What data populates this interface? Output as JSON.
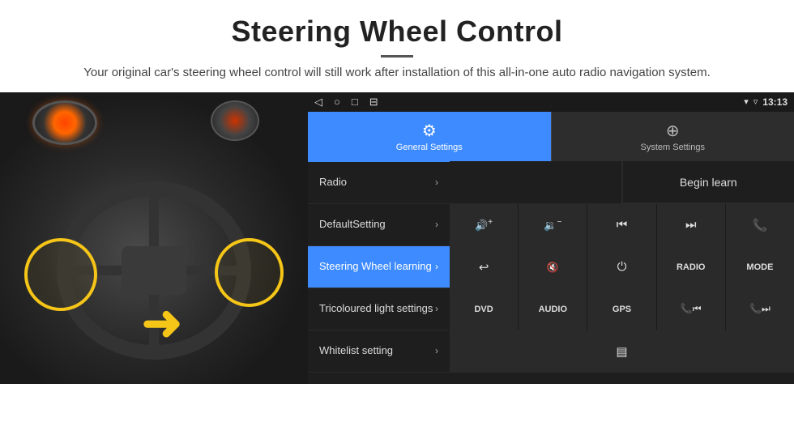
{
  "header": {
    "title": "Steering Wheel Control",
    "subtitle": "Your original car's steering wheel control will still work after installation of this all-in-one auto radio navigation system.",
    "divider": true
  },
  "status_bar": {
    "nav_back": "◁",
    "nav_home": "○",
    "nav_recent": "□",
    "nav_menu": "⊟",
    "signal_icon": "▾",
    "wifi_icon": "▿",
    "time": "13:13"
  },
  "tabs": [
    {
      "id": "general",
      "label": "General Settings",
      "icon": "⚙",
      "active": true
    },
    {
      "id": "system",
      "label": "System Settings",
      "icon": "⊕",
      "active": false
    }
  ],
  "menu_items": [
    {
      "id": "radio",
      "label": "Radio",
      "active": false
    },
    {
      "id": "default",
      "label": "DefaultSetting",
      "active": false
    },
    {
      "id": "steering",
      "label": "Steering Wheel learning",
      "active": true
    },
    {
      "id": "tricolour",
      "label": "Tricoloured light settings",
      "active": false
    },
    {
      "id": "whitelist",
      "label": "Whitelist setting",
      "active": false
    }
  ],
  "begin_learn_button": "Begin learn",
  "control_buttons": [
    [
      {
        "id": "vol_up",
        "icon": "🔊+",
        "text": "",
        "type": "icon"
      },
      {
        "id": "vol_down",
        "icon": "🔉−",
        "text": "",
        "type": "icon"
      },
      {
        "id": "prev_track",
        "icon": "⏮",
        "text": "",
        "type": "icon"
      },
      {
        "id": "next_track",
        "icon": "⏭",
        "text": "",
        "type": "icon"
      },
      {
        "id": "phone",
        "icon": "📞",
        "text": "",
        "type": "icon"
      }
    ],
    [
      {
        "id": "hang_up",
        "icon": "↩",
        "text": "",
        "type": "icon"
      },
      {
        "id": "mute",
        "icon": "🔇×",
        "text": "",
        "type": "icon"
      },
      {
        "id": "power",
        "icon": "⏻",
        "text": "",
        "type": "icon"
      },
      {
        "id": "radio_btn",
        "icon": "",
        "text": "RADIO",
        "type": "text"
      },
      {
        "id": "mode_btn",
        "icon": "",
        "text": "MODE",
        "type": "text"
      }
    ],
    [
      {
        "id": "dvd_btn",
        "icon": "",
        "text": "DVD",
        "type": "text"
      },
      {
        "id": "audio_btn",
        "icon": "",
        "text": "AUDIO",
        "type": "text"
      },
      {
        "id": "gps_btn",
        "icon": "",
        "text": "GPS",
        "type": "text"
      },
      {
        "id": "tel_prev",
        "icon": "📞⏮",
        "text": "",
        "type": "icon"
      },
      {
        "id": "tel_next",
        "icon": "📞⏭",
        "text": "",
        "type": "icon"
      }
    ],
    [
      {
        "id": "screen_btn",
        "icon": "▤",
        "text": "",
        "type": "icon"
      }
    ]
  ],
  "car_image": {
    "alt": "Car steering wheel image"
  }
}
